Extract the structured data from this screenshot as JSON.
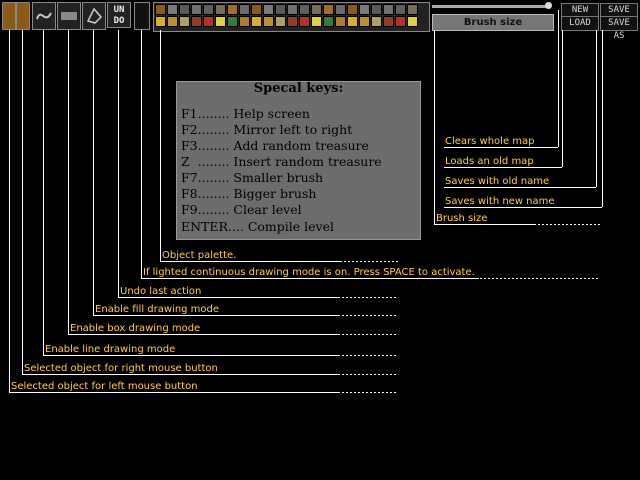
{
  "toolbar": {
    "undo_label": "UN DO",
    "brush_size_label": "Brush size",
    "new_label": "NEW",
    "load_label": "LOAD",
    "save_label": "SAVE",
    "save_as_label": "SAVE AS"
  },
  "special_keys": {
    "title": "Specal keys:",
    "rows": [
      {
        "key": "F1........",
        "desc": "Help screen"
      },
      {
        "key": "F2........",
        "desc": "Mirror left to right"
      },
      {
        "key": "F3........",
        "desc": "Add random treasure"
      },
      {
        "key": "Z  ........",
        "desc": "Insert random treasure"
      },
      {
        "key": "F7........",
        "desc": "Smaller brush"
      },
      {
        "key": "F8........",
        "desc": "Bigger brush"
      },
      {
        "key": "F9........",
        "desc": "Clear level"
      },
      {
        "key": "ENTER....",
        "desc": "Compile level"
      }
    ]
  },
  "annotations": {
    "clear": "Clears whole map",
    "load": "Loads an old map",
    "save": "Saves with old name",
    "save_as": "Saves with new name",
    "brush": "Brush size",
    "palette": "Object palette.",
    "continuous": "If lighted continuous drawing mode is on. Press SPACE to activate.",
    "undo": "Undo last action",
    "fill": "Enable fill drawing mode",
    "box": "Enable box drawing mode",
    "line": "Enable line drawing mode",
    "right_obj": "Selected object for right mouse button",
    "left_obj": "Selected object for left mouse button"
  },
  "colors": {
    "label": "#ffcf3a",
    "panel": "#6d6d6d"
  }
}
